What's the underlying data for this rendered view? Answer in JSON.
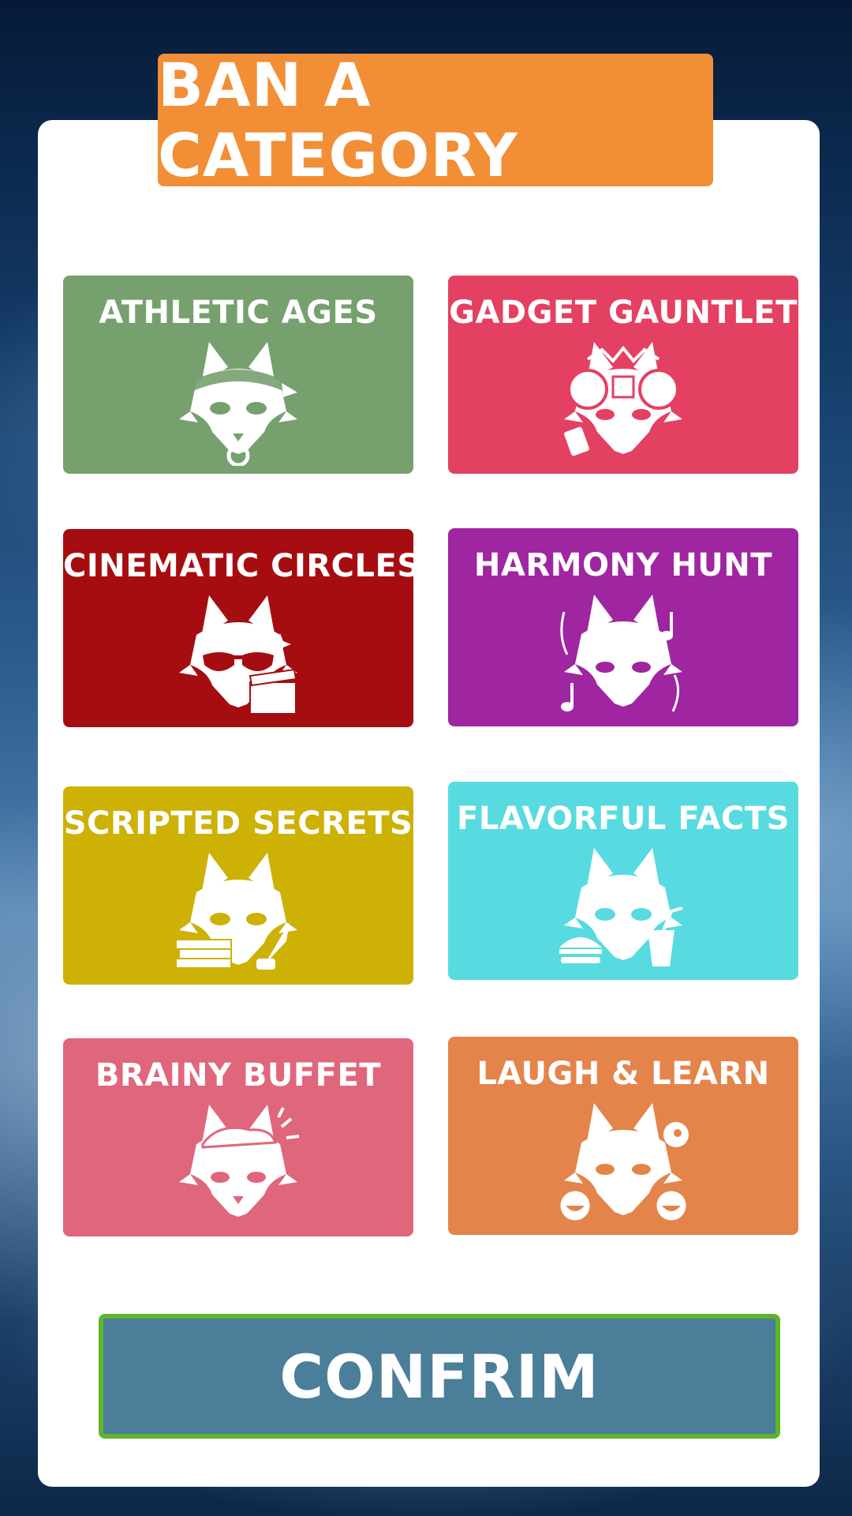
{
  "title": "BAN A CATEGORY",
  "categories": [
    {
      "label": "ATHLETIC AGES",
      "color": "#76a06e",
      "icon": "fox-headband-medal-icon"
    },
    {
      "label": "GADGET GAUNTLET",
      "color": "#e44062",
      "icon": "fox-headphones-circuit-icon"
    },
    {
      "label": "CINEMATIC CIRCLES",
      "color": "#a50d11",
      "icon": "fox-sunglasses-clapperboard-icon"
    },
    {
      "label": "HARMONY HUNT",
      "color": "#9f25a1",
      "icon": "fox-music-notes-icon"
    },
    {
      "label": "SCRIPTED SECRETS",
      "color": "#cdb105",
      "icon": "fox-books-quill-icon"
    },
    {
      "label": "FLAVORFUL FACTS",
      "color": "#57dbe0",
      "icon": "fox-burger-drink-icon"
    },
    {
      "label": "BRAINY BUFFET",
      "color": "#e0667b",
      "icon": "fox-brain-icon"
    },
    {
      "label": "LAUGH & LEARN",
      "color": "#e4844a",
      "icon": "fox-laughing-emoji-icon"
    }
  ],
  "confirm_label": "CONFRIM",
  "colors": {
    "title_banner": "#f28e36",
    "confirm_fill": "#4a7e99",
    "confirm_border": "#5db52a",
    "panel": "#ffffff"
  }
}
